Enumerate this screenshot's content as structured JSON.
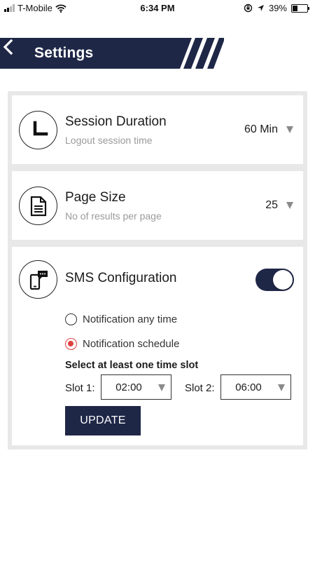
{
  "status_bar": {
    "carrier": "T-Mobile",
    "time": "6:34 PM",
    "battery": "39%",
    "battery_level": 0.39,
    "signal_bars": 2
  },
  "header": {
    "title": "Settings",
    "color": "#1f2747"
  },
  "settings": {
    "session_duration": {
      "title": "Session Duration",
      "subtitle": "Logout session time",
      "value": "60 Min",
      "icon": "clock-icon"
    },
    "page_size": {
      "title": "Page Size",
      "subtitle": "No of results per page",
      "value": "25",
      "icon": "document-icon"
    },
    "sms": {
      "title": "SMS Configuration",
      "icon": "phone-message-icon",
      "enabled": true,
      "options": [
        {
          "label": "Notification any time",
          "selected": false
        },
        {
          "label": "Notification schedule",
          "selected": true
        }
      ],
      "slot_hint": "Select at least one time slot",
      "slot1_label": "Slot 1:",
      "slot1_value": "02:00",
      "slot2_label": "Slot 2:",
      "slot2_value": "06:00",
      "update_label": "UPDATE"
    }
  },
  "colors": {
    "accent": "#1f2747",
    "radio_selected": "#e0413f",
    "panel_bg": "#e8e8e8",
    "subtitle": "#9a9a9a"
  }
}
